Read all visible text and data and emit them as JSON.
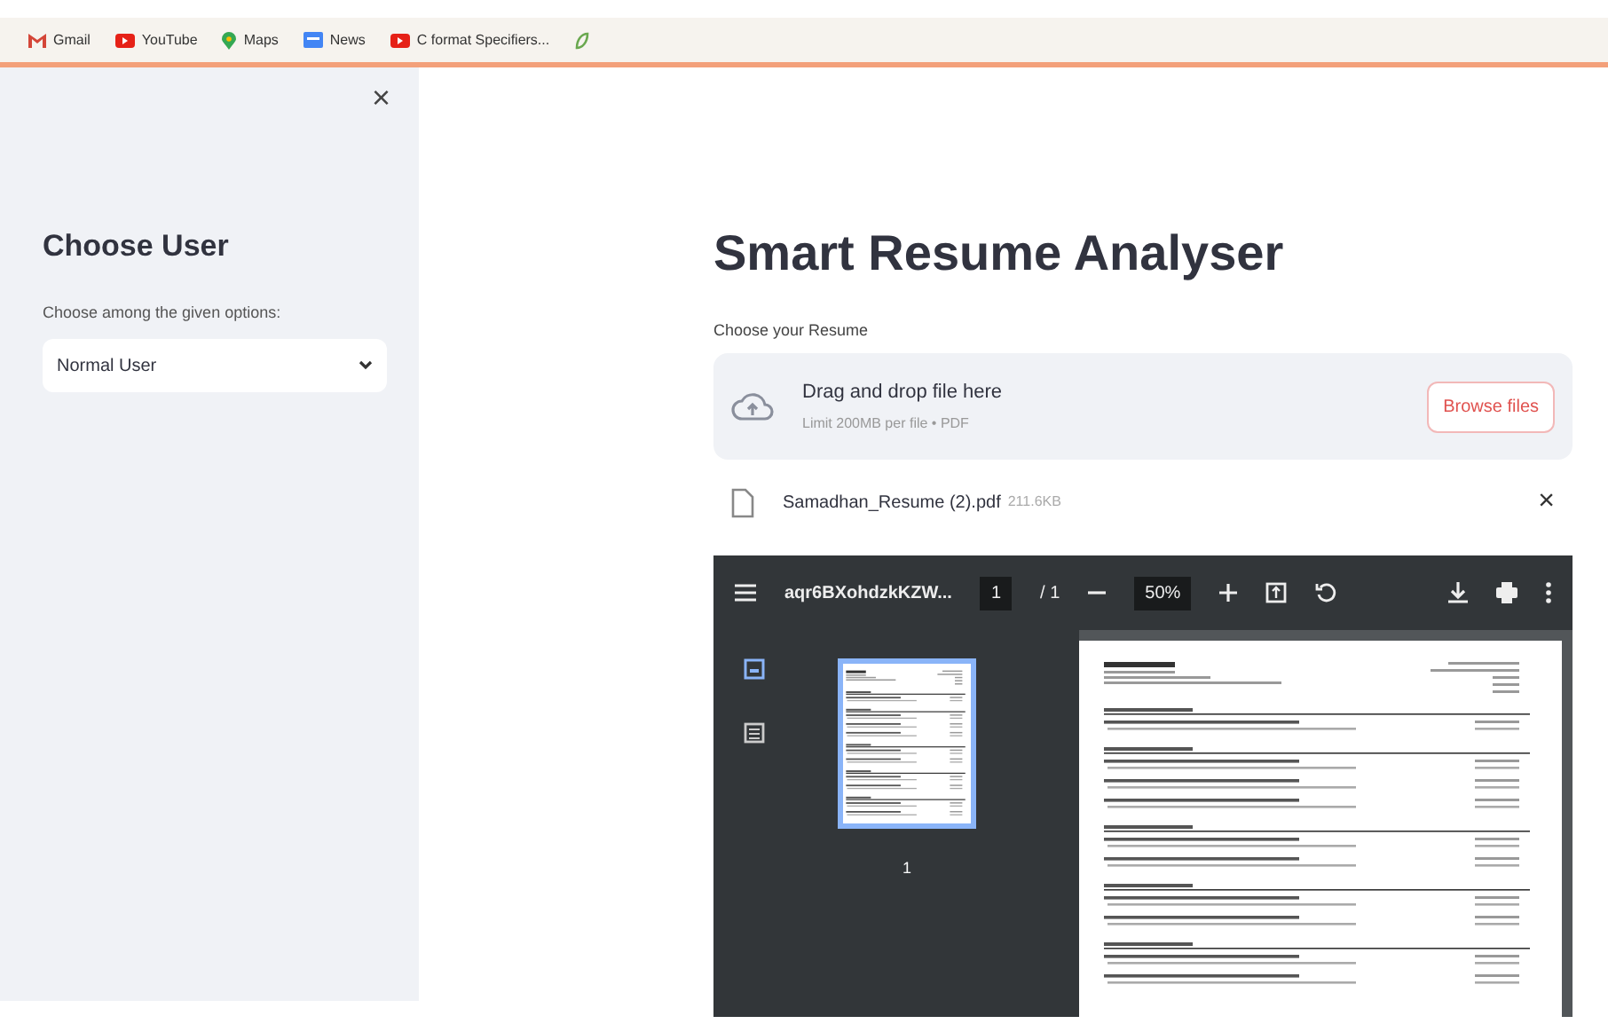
{
  "bookmarks": [
    {
      "label": "Gmail",
      "kind": "gmail"
    },
    {
      "label": "YouTube",
      "kind": "youtube"
    },
    {
      "label": "Maps",
      "kind": "maps"
    },
    {
      "label": "News",
      "kind": "news"
    },
    {
      "label": "C format Specifiers...",
      "kind": "youtube"
    },
    {
      "kind": "leaf"
    }
  ],
  "sidebar": {
    "close": "×",
    "heading": "Choose User",
    "select": {
      "label": "Choose among the given options:",
      "value": "Normal User"
    }
  },
  "main": {
    "title": "Smart Resume Analyser",
    "uploader": {
      "label": "Choose your Resume",
      "drop_text": "Drag and drop file here",
      "limit": "Limit 200MB per file • PDF",
      "button": "Browse files"
    },
    "file": {
      "name": "Samadhan_Resume (2).pdf",
      "size": "211.6KB",
      "remove": "×"
    },
    "pdf_viewer": {
      "file_name": "aqr6BXohdzkKZW...",
      "page": "1",
      "page_total": "/ 1",
      "zoom": "50%",
      "thumbnail_label": "1"
    }
  }
}
